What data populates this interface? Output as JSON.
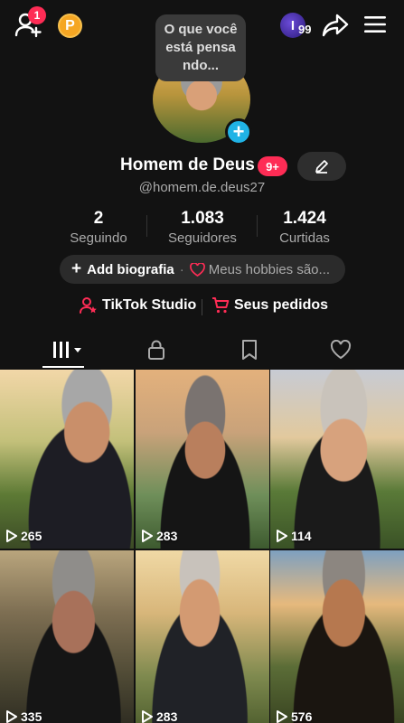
{
  "header": {
    "notification_count": "1",
    "coin_letter": "P",
    "mini_avatar_letter": "I",
    "mini_avatar_count": "99"
  },
  "tooltip": {
    "text": "O que você está pensa ndo..."
  },
  "profile": {
    "name": "Homem de Deus",
    "badge": "9+",
    "handle": "@homem.de.deus27"
  },
  "stats": [
    {
      "value": "2",
      "label": "Seguindo"
    },
    {
      "value": "1.083",
      "label": "Seguidores"
    },
    {
      "value": "1.424",
      "label": "Curtidas"
    }
  ],
  "bio": {
    "add_label": "Add biografia",
    "separator": "·",
    "hobbies": "Meus hobbies são..."
  },
  "links": {
    "studio": "TikTok Studio",
    "orders": "Seus pedidos"
  },
  "videos": [
    {
      "views": "265"
    },
    {
      "views": "283"
    },
    {
      "views": "114"
    },
    {
      "views": "335"
    },
    {
      "views": "283"
    },
    {
      "views": "576"
    }
  ],
  "colors": {
    "accent": "#fe2c55",
    "plus_blue": "#20b3e6",
    "coin": "#f5a623",
    "background": "#121212"
  }
}
